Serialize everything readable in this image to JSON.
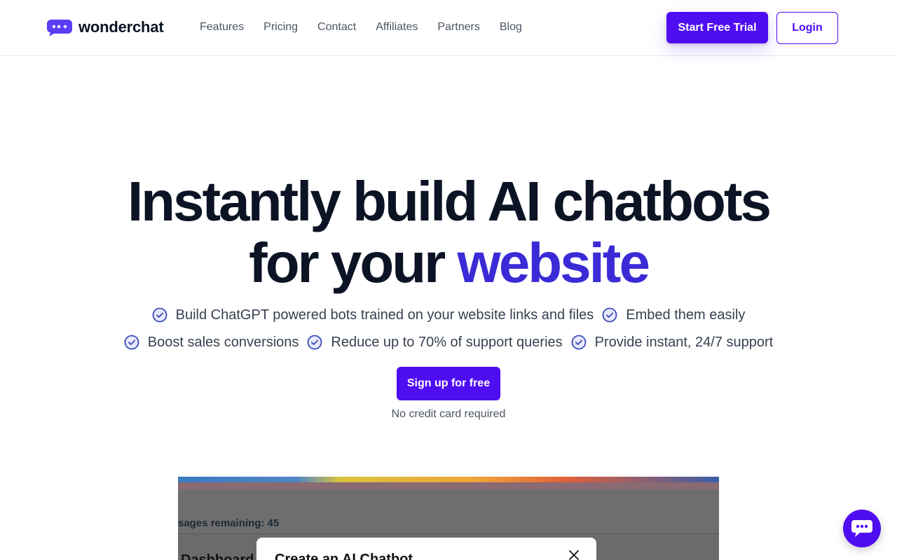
{
  "brand": {
    "name": "wonderchat",
    "logo_icon": "chat-bubble-dots-icon",
    "accent_color": "#4f0df2",
    "highlight_color": "#3b2bd6"
  },
  "nav": {
    "items": [
      {
        "label": "Features"
      },
      {
        "label": "Pricing"
      },
      {
        "label": "Contact"
      },
      {
        "label": "Affiliates"
      },
      {
        "label": "Partners"
      },
      {
        "label": "Blog"
      }
    ]
  },
  "header": {
    "trial_label": "Start Free Trial",
    "login_label": "Login"
  },
  "hero": {
    "title_line1": "Instantly build AI chatbots",
    "title_line2_plain": "for your ",
    "title_line2_accent": "website",
    "features_row1": [
      "Build ChatGPT powered bots trained on your website links and files",
      "Embed them easily"
    ],
    "features_row2": [
      "Boost sales conversions",
      "Reduce up to 70% of support queries",
      "Provide instant, 24/7 support"
    ],
    "feature_icon": "check-circle-icon",
    "cta_label": "Sign up for free",
    "cta_note": "No credit card required"
  },
  "preview": {
    "messages_text": "sages remaining: 45",
    "dashboard_text": "Dashboard",
    "modal_title": "Create an AI Chatbot",
    "close_icon": "close-icon"
  },
  "chat_launcher": {
    "icon": "chat-bubble-icon"
  }
}
